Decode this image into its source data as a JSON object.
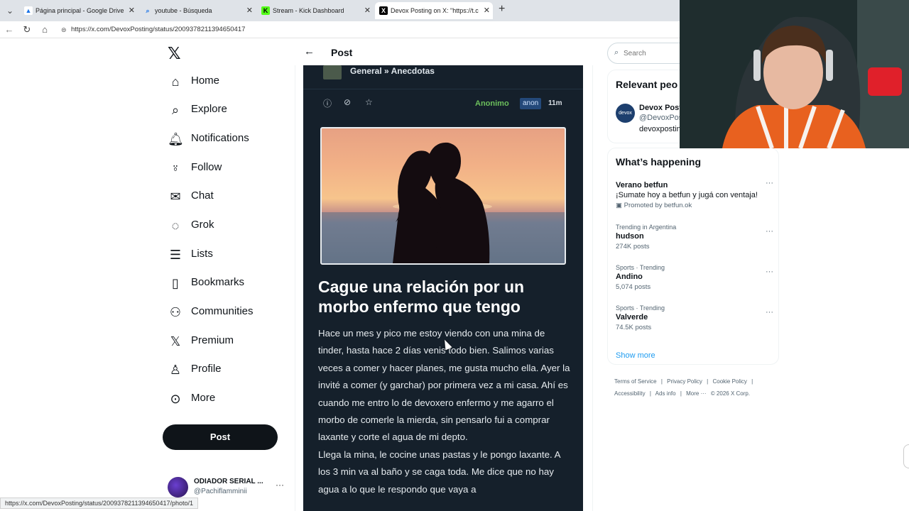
{
  "browser": {
    "tabs": [
      {
        "title": "Página principal - Google Drive",
        "favicon": "drive-icon",
        "active": false
      },
      {
        "title": "youtube - Búsqueda",
        "favicon": "search-icon",
        "active": false
      },
      {
        "title": "Stream - Kick Dashboard",
        "favicon": "kick-icon",
        "active": false
      },
      {
        "title": "Devox Posting on X: \"https://t.co/...",
        "favicon": "x-icon",
        "active": true
      }
    ],
    "url": "https://x.com/DevoxPosting/status/2009378211394650417",
    "status_url": "https://x.com/DevoxPosting/status/2009378211394650417/photo/1"
  },
  "sidebar": {
    "items": [
      {
        "label": "Home",
        "icon": "home-icon"
      },
      {
        "label": "Explore",
        "icon": "search-icon"
      },
      {
        "label": "Notifications",
        "icon": "bell-icon"
      },
      {
        "label": "Follow",
        "icon": "add-person-icon"
      },
      {
        "label": "Chat",
        "icon": "mail-icon"
      },
      {
        "label": "Grok",
        "icon": "grok-icon"
      },
      {
        "label": "Lists",
        "icon": "list-icon"
      },
      {
        "label": "Bookmarks",
        "icon": "bookmark-icon"
      },
      {
        "label": "Communities",
        "icon": "people-icon"
      },
      {
        "label": "Premium",
        "icon": "x-icon"
      },
      {
        "label": "Profile",
        "icon": "person-icon"
      },
      {
        "label": "More",
        "icon": "more-circle-icon"
      }
    ],
    "post_button": "Post",
    "account": {
      "name": "ODIADOR SERIAL ...",
      "handle": "@Pachiflamminii"
    }
  },
  "main": {
    "header_title": "Post",
    "media": {
      "breadcrumb": "General » Anecdotas",
      "author": "Anonimo",
      "badge": "anon",
      "time": "11m",
      "headline": "Cague una relación por un morbo enfermo que tengo",
      "paragraph_1": "Hace un mes y pico me estoy viendo con una mina de tinder, hasta hace 2 días venis todo bien. Salimos varias veces a comer y hacer planes, me gusta mucho ella. Ayer la invité a comer (y garchar) por primera vez a mi casa. Ahí es cuando me entro lo de devoxero enfermo y me agarro el morbo de comerle la mierda, sin pensarlo fui a comprar laxante y corte el agua de mi depto.",
      "paragraph_2": "Llega la mina, le cocine unas pastas y le pongo laxante. A los 3 min va al baño y se caga toda. Me dice que no hay agua a lo que le respondo que vaya a"
    }
  },
  "right": {
    "search_placeholder": "Search",
    "relevant_title": "Relevant peo",
    "relevant": {
      "name": "Devox Post",
      "handle": "@DevoxPos",
      "bio": "devoxpostin",
      "avatar_text": "devox"
    },
    "happening_title": "What’s happening",
    "trends": [
      {
        "context": "",
        "title": "Verano betfun",
        "line": "¡Sumate hoy a betfun y jugá con ventaja!",
        "sub": "Promoted by betfun.ok",
        "promoted": true
      },
      {
        "context": "Trending in Argentina",
        "title": "hudson",
        "line": "",
        "sub": "274K posts",
        "promoted": false
      },
      {
        "context": "Sports · Trending",
        "title": "Andino",
        "line": "",
        "sub": "5,074 posts",
        "promoted": false
      },
      {
        "context": "Sports · Trending",
        "title": "Valverde",
        "line": "",
        "sub": "74.5K posts",
        "promoted": false
      }
    ],
    "show_more": "Show more",
    "footer": [
      "Terms of Service",
      "|",
      "Privacy Policy",
      "|",
      "Cookie Policy",
      "|",
      "Accessibility",
      "|",
      "Ads info",
      "|",
      "More ···",
      "© 2026 X Corp."
    ]
  }
}
